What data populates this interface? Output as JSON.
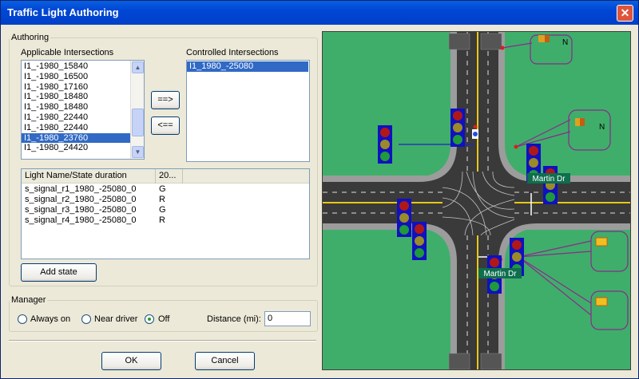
{
  "window": {
    "title": "Traffic Light Authoring",
    "close_glyph": "✕"
  },
  "authoring": {
    "group_label": "Authoring",
    "applicable_label": "Applicable Intersections",
    "controlled_label": "Controlled Intersections",
    "applicable_items": [
      "I1_-1980_15840",
      "I1_-1980_16500",
      "I1_-1980_17160",
      "I1_-1980_18480",
      "I1_-1980_18480",
      "I1_-1980_22440",
      "I1_-1980_22440",
      "I1_-1980_23760",
      "I1_-1980_24420"
    ],
    "applicable_selected_index": 7,
    "controlled_items": [
      "I1_1980_-25080"
    ],
    "add_button": "==>",
    "remove_button": "<==",
    "table_headers": [
      "Light Name/State duration",
      "20..."
    ],
    "table_rows": [
      [
        "s_signal_r1_1980_-25080_0",
        "G"
      ],
      [
        "s_signal_r2_1980_-25080_0",
        "R"
      ],
      [
        "s_signal_r3_1980_-25080_0",
        "G"
      ],
      [
        "s_signal_r4_1980_-25080_0",
        "R"
      ]
    ],
    "add_state_button": "Add state"
  },
  "manager": {
    "group_label": "Manager",
    "options": [
      "Always on",
      "Near driver",
      "Off"
    ],
    "selected": "Off",
    "distance_label": "Distance (mi):",
    "distance_value": "0"
  },
  "footer": {
    "ok": "OK",
    "cancel": "Cancel"
  },
  "map": {
    "street_labels": [
      "Martin Dr",
      "Martin Dr"
    ],
    "north_labels": [
      "N",
      "N"
    ],
    "colors": {
      "grass": "#3FAE6B",
      "road": "#3A3A3A",
      "sidewalk": "#9A9A9A",
      "signal_frame": "#1010C0"
    }
  }
}
